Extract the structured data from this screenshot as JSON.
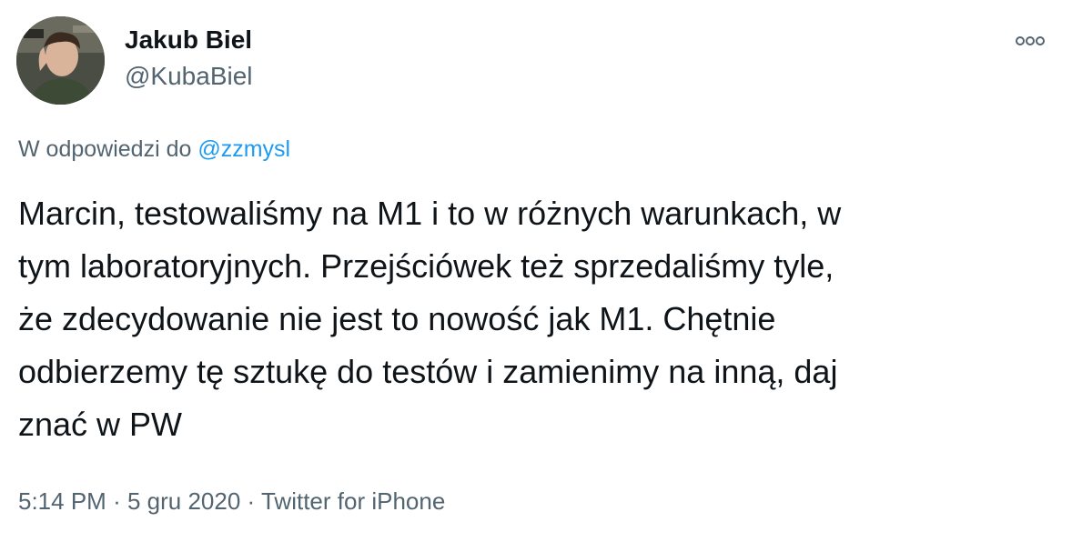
{
  "author": {
    "name": "Jakub Biel",
    "handle": "@KubaBiel"
  },
  "reply": {
    "prefix": "W odpowiedzi do",
    "mention": "@zzmysl"
  },
  "tweet": {
    "lines": [
      "Marcin, testowaliśmy na M1 i to w różnych warunkach, w",
      "tym laboratoryjnych. Przejściówek też sprzedaliśmy tyle,",
      "że zdecydowanie nie jest to nowość jak M1. Chętnie",
      "odbierzemy tę sztukę do testów i zamienimy na inną, daj",
      "znać w PW"
    ]
  },
  "meta": {
    "time": "5:14 PM",
    "separator": "·",
    "date": "5 gru 2020",
    "source": "Twitter for iPhone"
  },
  "icons": {
    "more": "more-horizontal-icon",
    "avatar": "avatar-photo"
  },
  "colors": {
    "text": "#0f1419",
    "secondary": "#536471",
    "link": "#1d9bf0"
  }
}
